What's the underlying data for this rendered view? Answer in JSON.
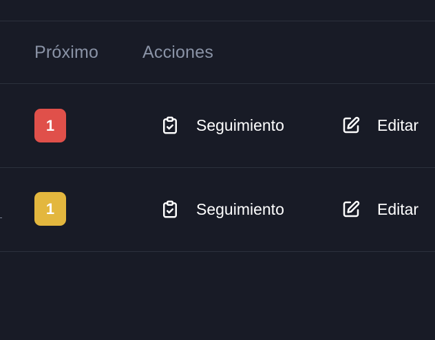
{
  "table": {
    "headers": {
      "next": "Próximo",
      "actions": "Acciones"
    },
    "rows": [
      {
        "badge": {
          "value": "1",
          "color": "#e0504a"
        },
        "actions": {
          "follow_up": "Seguimiento",
          "edit": "Editar"
        },
        "icons": {
          "follow_up": "clipboard-check-icon",
          "edit": "edit-pencil-icon"
        }
      },
      {
        "badge": {
          "value": "1",
          "color": "#e3b73e"
        },
        "actions": {
          "follow_up": "Seguimiento",
          "edit": "Editar"
        },
        "icons": {
          "follow_up": "clipboard-check-icon",
          "edit": "edit-pencil-icon"
        }
      }
    ]
  },
  "colors": {
    "background": "#181b26",
    "divider": "#2c313d",
    "header_text": "#8a93a6"
  }
}
